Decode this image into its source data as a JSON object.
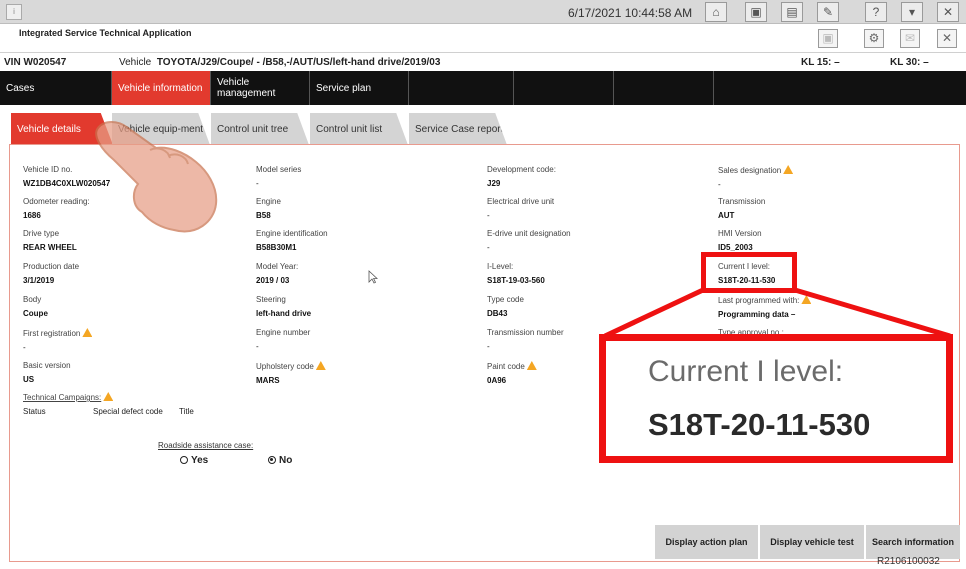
{
  "topbar": {
    "datetime": "6/17/2021 10:44:58 AM"
  },
  "app": {
    "title": "Integrated Service Technical Application"
  },
  "vehicle_bar": {
    "vin": "VIN  W020547",
    "vehicle_label": "Vehicle",
    "vehicle_value": "TOYOTA/J29/Coupe/ - /B58,-/AUT/US/left-hand drive/2019/03",
    "kl15": "KL 15:  –",
    "kl30": "KL 30:  –"
  },
  "main_tabs": [
    "Cases",
    "Vehicle information",
    "Vehicle management",
    "Service plan"
  ],
  "sub_tabs": [
    "Vehicle details",
    "Vehicle equip-ment",
    "Control unit tree",
    "Control unit list",
    "Service Case report"
  ],
  "details": {
    "col1": [
      {
        "label": "Vehicle ID no.",
        "value": "WZ1DB4C0XLW020547"
      },
      {
        "label": "Odometer reading:",
        "value": "1686"
      },
      {
        "label": "Drive type",
        "value": "REAR WHEEL"
      },
      {
        "label": "Production date",
        "value": "3/1/2019"
      },
      {
        "label": "Body",
        "value": "Coupe"
      },
      {
        "label": "First registration",
        "value": "-"
      },
      {
        "label": "Basic version",
        "value": "US"
      }
    ],
    "col2": [
      {
        "label": "Model series",
        "value": "-"
      },
      {
        "label": "Engine",
        "value": "B58"
      },
      {
        "label": "Engine identification",
        "value": "B58B30M1"
      },
      {
        "label": "Model Year:",
        "value": "2019 / 03"
      },
      {
        "label": "Steering",
        "value": "left-hand drive"
      },
      {
        "label": "Engine number",
        "value": "-"
      },
      {
        "label": "Upholstery code",
        "value": "MARS"
      }
    ],
    "col3": [
      {
        "label": "Development code:",
        "value": "J29"
      },
      {
        "label": "Electrical drive unit",
        "value": "-"
      },
      {
        "label": "E-drive unit designation",
        "value": "-"
      },
      {
        "label": "I-Level:",
        "value": "S18T-19-03-560"
      },
      {
        "label": "Type code",
        "value": "DB43"
      },
      {
        "label": "Transmission number",
        "value": "-"
      },
      {
        "label": "Paint code",
        "value": "0A96"
      }
    ],
    "col4": [
      {
        "label": "Sales designation",
        "value": "-"
      },
      {
        "label": "Transmission",
        "value": "AUT"
      },
      {
        "label": "HMI Version",
        "value": "ID5_2003"
      },
      {
        "label": "Current I level:",
        "value": "S18T-20-11-530"
      },
      {
        "label": "Last programmed with:",
        "value": "Programming data –"
      },
      {
        "label": "Type approval no.:",
        "value": ""
      }
    ]
  },
  "technical_campaigns": {
    "title": "Technical Campaigns:",
    "columns": [
      "Status",
      "Special defect code",
      "Title"
    ]
  },
  "roadside": {
    "title": "Roadside assistance case:",
    "yes": "Yes",
    "no": "No",
    "selected": "No"
  },
  "buttons": [
    "Display action plan",
    "Display vehicle test",
    "Search information"
  ],
  "zoom": {
    "label": "Current I level:",
    "value": "S18T-20-11-530"
  },
  "figure_code": "R2106100032",
  "colors": {
    "accent": "#e23a2e",
    "highlight": "#ee1111",
    "warning": "#f4a623"
  }
}
